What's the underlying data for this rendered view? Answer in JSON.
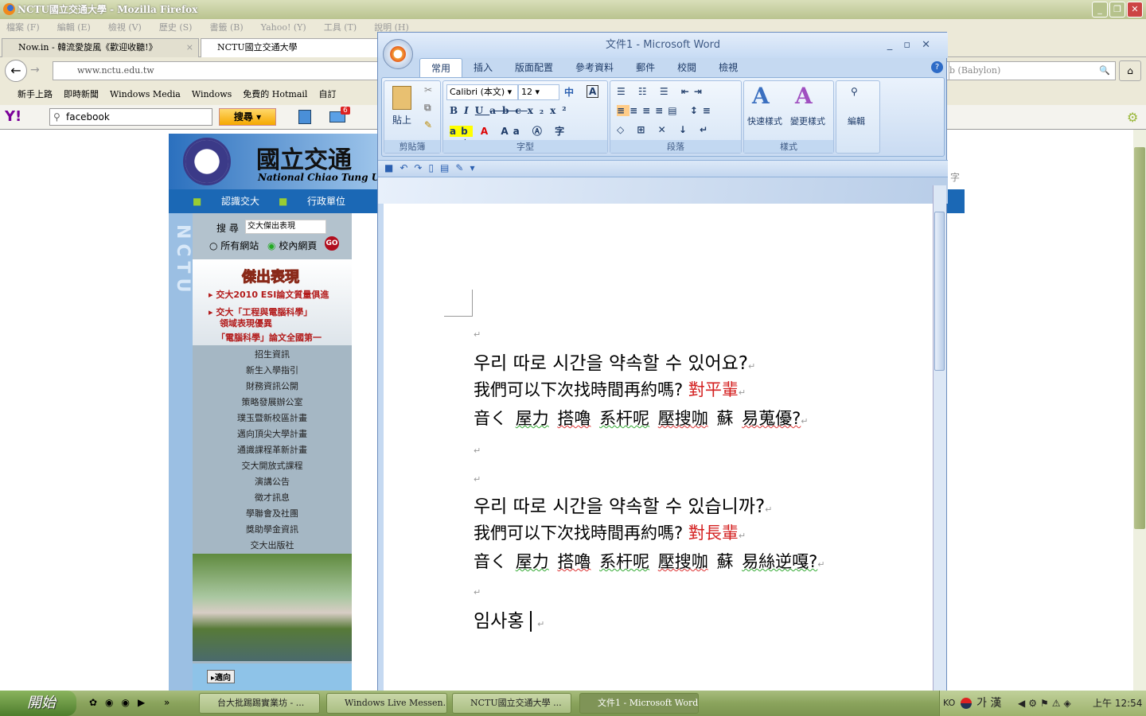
{
  "firefox": {
    "title": "NCTU國立交通大學 - Mozilla Firefox",
    "menu": [
      "檔案 (F)",
      "編輯 (E)",
      "檢視 (V)",
      "歷史 (S)",
      "書籤 (B)",
      "Yahoo! (Y)",
      "工具 (T)",
      "說明 (H)"
    ],
    "tabs": [
      {
        "label": "Now.in - 韓流愛旋風《歡迎收聽!》"
      },
      {
        "label": "NCTU國立交通大學"
      }
    ],
    "url": "www.nctu.edu.tw",
    "search_engine": "b (Babylon)",
    "bookmarks": [
      "新手上路",
      "即時新聞",
      "Windows Media",
      "Windows",
      "免費的 Hotmail",
      "自訂"
    ],
    "yahoo_search": "facebook",
    "yahoo_button": "搜尋",
    "mail_count": "6"
  },
  "site": {
    "title_cn": "國立交通",
    "title_en": "National Chiao Tung U",
    "nav": [
      "認識交大",
      "行政單位"
    ],
    "strip": "NCTU",
    "search_label": "搜 尋",
    "search_value": "交大傑出表現",
    "radio_all": "所有網站",
    "radio_campus": "校內網頁",
    "go": "GO",
    "featured_title": "傑出表現",
    "featured": [
      "交大2010 ESI論文質量俱進",
      "交大「工程與電腦科學」",
      "領域表現優異",
      "「電腦科學」論文全國第一"
    ],
    "menu": [
      "招生資訊",
      "新生入學指引",
      "財務資訊公開",
      "策略發展辦公室",
      "璞玉暨新校區計畫",
      "邁向頂尖大學計畫",
      "通識課程革新計畫",
      "交大開放式課程",
      "演講公告",
      "徵才訊息",
      "學聯會及社團",
      "獎助學金資訊",
      "交大出版社"
    ],
    "banner_btn": "▸適向",
    "side_char": "字"
  },
  "word": {
    "title": "文件1 - Microsoft Word",
    "tabs": [
      "常用",
      "插入",
      "版面配置",
      "參考資料",
      "郵件",
      "校閱",
      "檢視"
    ],
    "font": "Calibri (本文)",
    "size": "12",
    "groups": [
      "剪貼簿",
      "字型",
      "段落",
      "樣式",
      ""
    ],
    "paste": "貼上",
    "quick_styles": "快速樣式",
    "change_styles": "變更樣式",
    "edit": "編輯",
    "doc": {
      "l1": "우리 따로 시간을 약속할 수 있어요?",
      "l2a": "我們可以下次找時間再約嗎? ",
      "l2b": "對平輩",
      "l3": [
        "音く",
        "屋力",
        "搭嚕",
        "系杆呢",
        "壓搜咖",
        "蘇",
        "易蒐優?"
      ],
      "l4": "우리 따로 시간을 약속할 수 있습니까?",
      "l5a": "我們可以下次找時間再約嗎? ",
      "l5b": "對長輩",
      "l6": [
        "音く",
        "屋力",
        "搭嚕",
        "系杆呢",
        "壓搜咖",
        "蘇",
        "易絲逆嘎?"
      ],
      "l7": "임사홍 ",
      "pm": "↵"
    }
  },
  "taskbar": {
    "start": "開始",
    "items": [
      "台大批踢踢實業坊 - ...",
      "Windows Live Messen...",
      "NCTU國立交通大學 ...",
      "文件1 - Microsoft Word"
    ],
    "lang": "KO",
    "ime": "가 漢",
    "clock": "上午 12:54"
  }
}
